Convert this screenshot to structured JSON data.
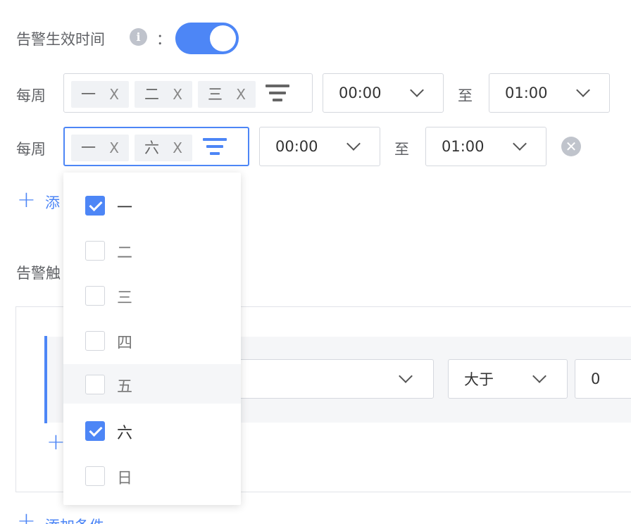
{
  "effective_time": {
    "label": "告警生效时间",
    "colon": "：",
    "info_icon": "info-icon",
    "toggle_on": true
  },
  "rows": [
    {
      "label": "每周",
      "tags": [
        {
          "text": "一",
          "remove": "X"
        },
        {
          "text": "二",
          "remove": "X"
        },
        {
          "text": "三",
          "remove": "X"
        }
      ],
      "start": "00:00",
      "to": "至",
      "end": "01:00"
    },
    {
      "label": "每周",
      "tags": [
        {
          "text": "一",
          "remove": "X"
        },
        {
          "text": "六",
          "remove": "X"
        }
      ],
      "start": "00:00",
      "to": "至",
      "end": "01:00"
    }
  ],
  "remove_icon_glyph": "✕",
  "add_time_link": {
    "plus": "+",
    "text": "添"
  },
  "trigger_section": {
    "label": "告警触"
  },
  "condition": {
    "operator": "大于",
    "value": "0",
    "plus": "+"
  },
  "add_condition": {
    "plus": "+",
    "text": "添加条件"
  },
  "dropdown": {
    "items": [
      {
        "label": "一",
        "checked": true
      },
      {
        "label": "二",
        "checked": false
      },
      {
        "label": "三",
        "checked": false
      },
      {
        "label": "四",
        "checked": false
      },
      {
        "label": "五",
        "checked": false,
        "hover": true
      },
      {
        "label": "六",
        "checked": true
      },
      {
        "label": "日",
        "checked": false
      }
    ]
  },
  "colors": {
    "accent": "#4d86f6",
    "border": "#d5d8de",
    "muted": "#606266"
  }
}
